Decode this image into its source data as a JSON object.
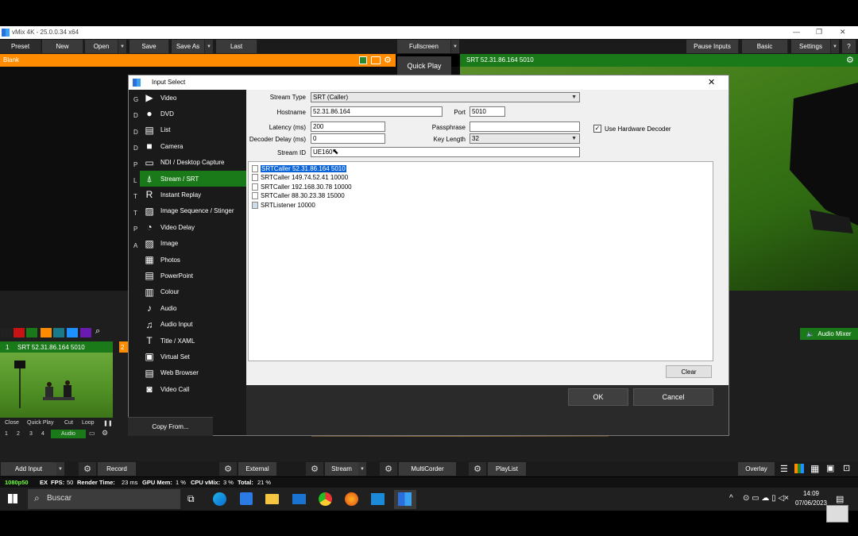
{
  "app": {
    "title": "vMix 4K - 25.0.0.34 x64"
  },
  "toolbar": {
    "preset": "Preset",
    "new": "New",
    "open": "Open",
    "save": "Save",
    "save_as": "Save As",
    "last": "Last",
    "fullscreen": "Fullscreen",
    "pause_inputs": "Pause Inputs",
    "basic": "Basic",
    "settings": "Settings",
    "help": "?"
  },
  "preview": {
    "label": "Blank",
    "quick_play": "Quick Play"
  },
  "output": {
    "label": "SRT 52.31.86.164 5010"
  },
  "input_thumb": {
    "number": "1",
    "title": "SRT 52.31.86.164 5010",
    "second_number": "2",
    "controls": [
      "Close",
      "Quick Play",
      "Cut",
      "Loop",
      "❚❚"
    ],
    "numbers": [
      "1",
      "2",
      "3",
      "4"
    ],
    "audio": "Audio"
  },
  "audio_mixer": "Audio Mixer",
  "bottom": {
    "add_input": "Add Input",
    "record": "Record",
    "external": "External",
    "stream": "Stream",
    "multicorder": "MultiCorder",
    "playlist": "PlayList",
    "overlay": "Overlay"
  },
  "status": {
    "resolution": "1080p50",
    "ex": "EX",
    "fps_label": "FPS:",
    "fps": "50",
    "render_label": "Render Time:",
    "render": "23 ms",
    "gpu_label": "GPU Mem:",
    "gpu": "1 %",
    "cpu_label": "CPU vMix:",
    "cpu": "3 %",
    "total_label": "Total:",
    "total": "21 %"
  },
  "taskbar": {
    "search": "Buscar",
    "time": "14:09",
    "date": "07/06/2023"
  },
  "dialog": {
    "title": "Input Select",
    "categories": [
      {
        "label": "Video",
        "icon": "video-icon"
      },
      {
        "label": "DVD",
        "icon": "dvd-icon"
      },
      {
        "label": "List",
        "icon": "list-icon"
      },
      {
        "label": "Camera",
        "icon": "camera-icon"
      },
      {
        "label": "NDI / Desktop Capture",
        "icon": "monitor-icon"
      },
      {
        "label": "Stream / SRT",
        "icon": "antenna-icon"
      },
      {
        "label": "Instant Replay",
        "icon": "replay-icon"
      },
      {
        "label": "Image Sequence / Stinger",
        "icon": "image-sequence-icon"
      },
      {
        "label": "Video Delay",
        "icon": "clock-icon"
      },
      {
        "label": "Image",
        "icon": "image-icon"
      },
      {
        "label": "Photos",
        "icon": "photos-icon"
      },
      {
        "label": "PowerPoint",
        "icon": "powerpoint-icon"
      },
      {
        "label": "Colour",
        "icon": "colour-icon"
      },
      {
        "label": "Audio",
        "icon": "microphone-icon"
      },
      {
        "label": "Audio Input",
        "icon": "audio-input-icon"
      },
      {
        "label": "Title / XAML",
        "icon": "title-icon"
      },
      {
        "label": "Virtual Set",
        "icon": "virtual-set-icon"
      },
      {
        "label": "Web Browser",
        "icon": "web-browser-icon"
      },
      {
        "label": "Video Call",
        "icon": "video-call-icon"
      }
    ],
    "selected_category": "Stream / SRT",
    "left_letters": [
      "G",
      "D",
      "D",
      "D",
      "P",
      "L",
      "T",
      "T",
      "P",
      "A"
    ],
    "stream_type_label": "Stream Type",
    "stream_type": "SRT (Caller)",
    "hostname_label": "Hostname",
    "hostname": "52.31.86.164",
    "port_label": "Port",
    "port": "5010",
    "latency_label": "Latency (ms)",
    "latency": "200",
    "passphrase_label": "Passphrase",
    "passphrase": "",
    "decoder_delay_label": "Decoder Delay (ms)",
    "decoder_delay": "0",
    "key_length_label": "Key Length",
    "key_length": "32",
    "stream_id_label": "Stream ID",
    "stream_id": "UE160",
    "hw_decoder_label": "Use Hardware Decoder",
    "hw_decoder_checked": true,
    "list": [
      "SRTCaller 52.31.86.164 5010",
      "SRTCaller 149.74.52.41 10000",
      "SRTCaller 192.168.30.78 10000",
      "SRTCaller 88.30.23.38 15000",
      "SRTListener  10000"
    ],
    "clear": "Clear",
    "ok": "OK",
    "cancel": "Cancel",
    "copy_from": "Copy From..."
  },
  "colors": {
    "accent_orange": "#ff8c00",
    "accent_green": "#1a7a1a",
    "selection_blue": "#0a64d8"
  }
}
